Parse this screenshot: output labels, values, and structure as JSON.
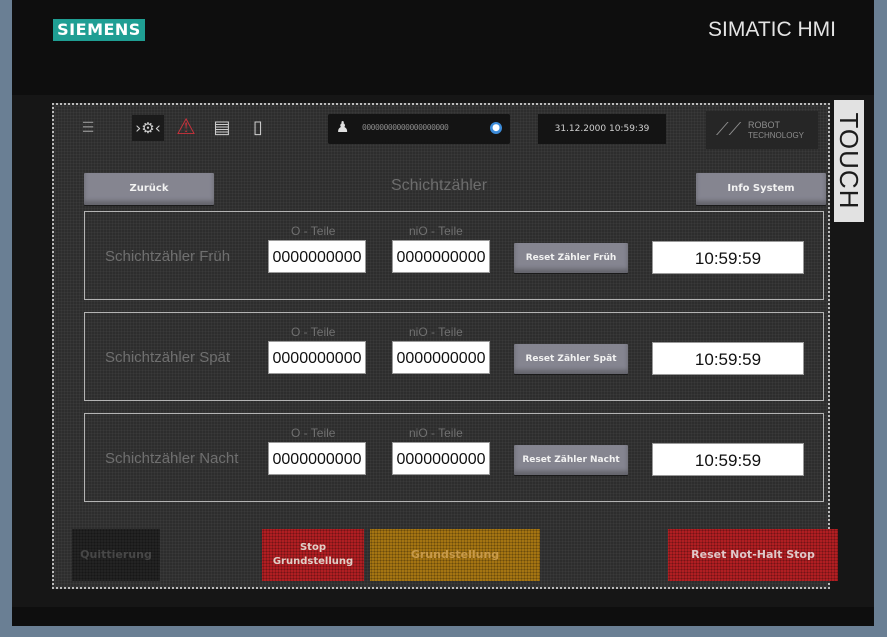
{
  "bezel": {
    "brand": "SIEMENS",
    "model": "SIMATIC HMI",
    "touch_label": "TOUCH"
  },
  "header": {
    "menu_icon": "menu-icon",
    "user_icon": "user-switch-icon",
    "alarm_icon": "warning-triangle-icon",
    "list_icon": "list-icon",
    "exit_icon": "door-exit-icon",
    "user_field": "00000000000000000000",
    "datetime": "31.12.2000 10:59:39",
    "logo_line1": "ROBOT",
    "logo_line2": "TECHNOLOGY"
  },
  "page": {
    "back_label": "Zurück",
    "title": "Schichtzähler",
    "info_label": "Info System"
  },
  "shifts": [
    {
      "label": "Schichtzähler Früh",
      "io_header": "O - Teile",
      "nio_header": "niO - Teile",
      "io_value": "0000000000",
      "nio_value": "0000000000",
      "reset_label": "Reset Zähler Früh",
      "time": "10:59:59"
    },
    {
      "label": "Schichtzähler Spät",
      "io_header": "O - Teile",
      "nio_header": "niO - Teile",
      "io_value": "0000000000",
      "nio_value": "0000000000",
      "reset_label": "Reset Zähler Spät",
      "time": "10:59:59"
    },
    {
      "label": "Schichtzähler Nacht",
      "io_header": "O - Teile",
      "nio_header": "niO - Teile",
      "io_value": "0000000000",
      "nio_value": "0000000000",
      "reset_label": "Reset Zähler Nacht",
      "time": "10:59:59"
    }
  ],
  "footer": {
    "quit_label": "Quittierung",
    "stop_line1": "Stop",
    "stop_line2": "Grundstellung",
    "grund_label": "Grundstellung",
    "reset_notaus_label": "Reset Not-Halt Stop"
  },
  "colors": {
    "brand": "#1f9e93",
    "alarm_red": "#b01e22",
    "warning_amber": "#a47412",
    "button_grey": "#858590"
  }
}
